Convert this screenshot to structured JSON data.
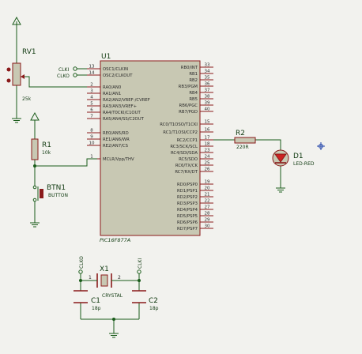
{
  "colors": {
    "background": "#f2f2ee",
    "wire": "#1a5c1a",
    "chip_fill": "#c8c8b3",
    "chip_border": "#8a1a1a",
    "pin_text": "#2a2a2a",
    "component_label": "#103a10",
    "pin_number": "#2a2a2a",
    "component_body": "#8a1a1a",
    "component_fill": "#c8c8b3",
    "led_fill": "#cc2222",
    "marker": "#2244aa"
  },
  "mcu": {
    "ref": "U1",
    "part": "PIC16F877A",
    "left_pins": [
      {
        "num": "13",
        "name": "OSC1/CLKIN"
      },
      {
        "num": "14",
        "name": "OSC2/CLKOUT"
      },
      {
        "num": "2",
        "name": "RA0/AN0"
      },
      {
        "num": "3",
        "name": "RA1/AN1"
      },
      {
        "num": "4",
        "name": "RA2/AN2/VREF-/CVREF"
      },
      {
        "num": "5",
        "name": "RA3/AN3/VREF+"
      },
      {
        "num": "6",
        "name": "RA4/T0CKI/C1OUT"
      },
      {
        "num": "7",
        "name": "RA5/AN4/SS/C2OUT"
      },
      {
        "num": "8",
        "name": "RE0/AN5/RD"
      },
      {
        "num": "9",
        "name": "RE1/AN6/WR"
      },
      {
        "num": "10",
        "name": "RE2/AN7/CS"
      },
      {
        "num": "1",
        "name": "MCLR/Vpp/THV"
      }
    ],
    "right_pins": [
      {
        "num": "33",
        "name": "RB0/INT"
      },
      {
        "num": "34",
        "name": "RB1"
      },
      {
        "num": "35",
        "name": "RB2"
      },
      {
        "num": "36",
        "name": "RB3/PGM"
      },
      {
        "num": "37",
        "name": "RB4"
      },
      {
        "num": "38",
        "name": "RB5"
      },
      {
        "num": "39",
        "name": "RB6/PGC"
      },
      {
        "num": "40",
        "name": "RB7/PGD"
      },
      {
        "num": "15",
        "name": "RC0/T1OSO/T1CKI"
      },
      {
        "num": "16",
        "name": "RC1/T1OSI/CCP2"
      },
      {
        "num": "17",
        "name": "RC2/CCP1"
      },
      {
        "num": "18",
        "name": "RC3/SCK/SCL"
      },
      {
        "num": "23",
        "name": "RC4/SDI/SDA"
      },
      {
        "num": "24",
        "name": "RC5/SDO"
      },
      {
        "num": "25",
        "name": "RC6/TX/CK"
      },
      {
        "num": "26",
        "name": "RC7/RX/DT"
      },
      {
        "num": "19",
        "name": "RD0/PSP0"
      },
      {
        "num": "20",
        "name": "RD1/PSP1"
      },
      {
        "num": "21",
        "name": "RD2/PSP2"
      },
      {
        "num": "22",
        "name": "RD3/PSP3"
      },
      {
        "num": "27",
        "name": "RD4/PSP4"
      },
      {
        "num": "28",
        "name": "RD5/PSP5"
      },
      {
        "num": "29",
        "name": "RD6/PSP6"
      },
      {
        "num": "30",
        "name": "RD7/PSP7"
      }
    ],
    "clock_labels": {
      "clki": "CLKI",
      "clko": "CLKO"
    }
  },
  "rv1": {
    "ref": "RV1",
    "value": "25k"
  },
  "r1": {
    "ref": "R1",
    "value": "10k"
  },
  "btn1": {
    "ref": "BTN1",
    "value": "BUTTON"
  },
  "r2": {
    "ref": "R2",
    "value": "220R"
  },
  "d1": {
    "ref": "D1",
    "value": "LED-RED"
  },
  "x1": {
    "ref": "X1",
    "value": "CRYSTAL",
    "pin1": "1",
    "pin2": "2",
    "label_left": "CLKO",
    "label_right": "CLKI"
  },
  "c1": {
    "ref": "C1",
    "value": "18p"
  },
  "c2": {
    "ref": "C2",
    "value": "18p"
  }
}
